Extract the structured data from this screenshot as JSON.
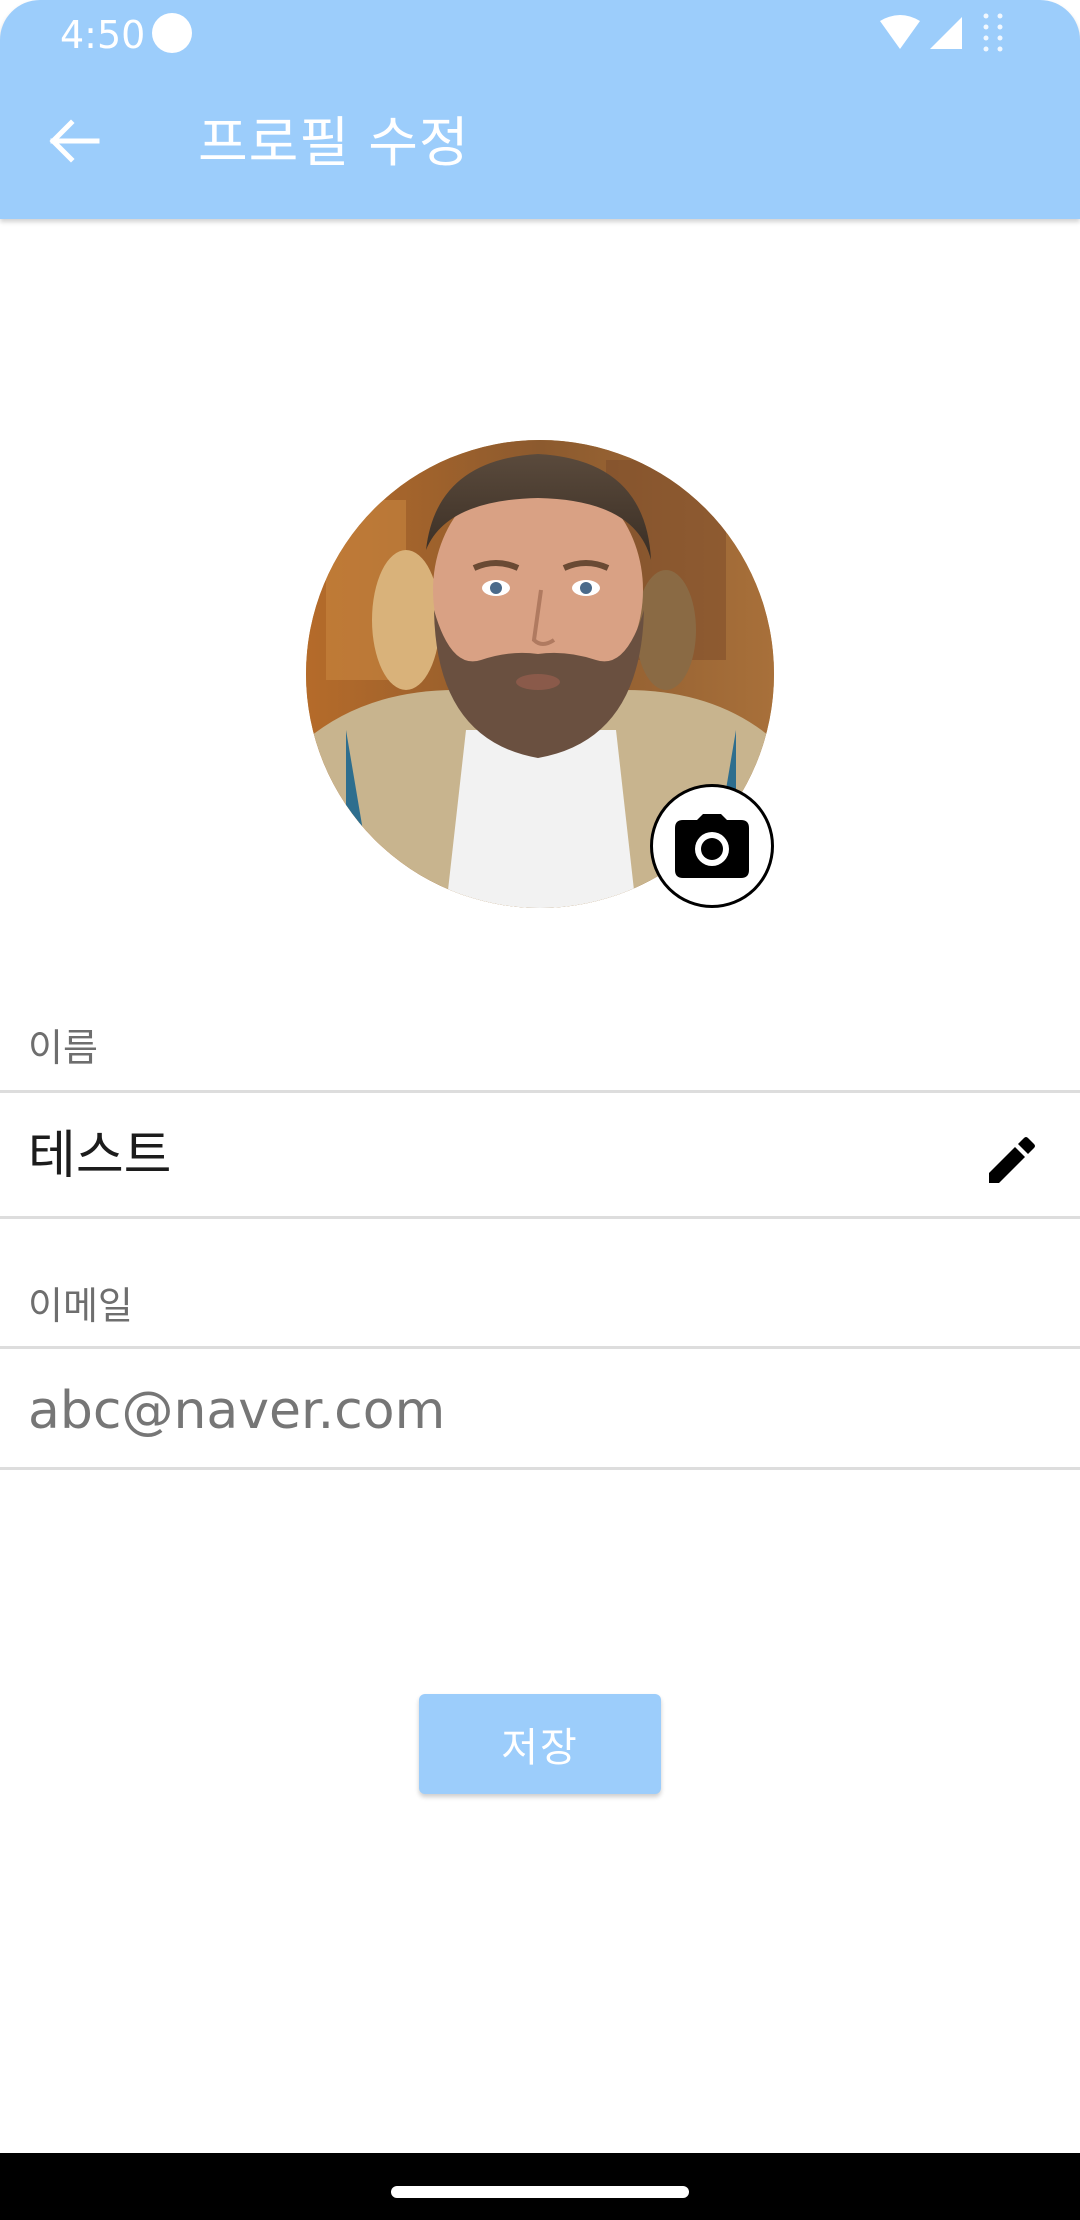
{
  "status_bar": {
    "time": "4:50",
    "icons": [
      "notification-dot-icon",
      "wifi-icon",
      "signal-icon",
      "battery-icon"
    ]
  },
  "app_bar": {
    "back_icon": "arrow-left-icon",
    "title": "프로필 수정"
  },
  "profile": {
    "avatar": "profile-photo",
    "camera_icon": "camera-icon"
  },
  "form": {
    "name": {
      "label": "이름",
      "value": "테스트",
      "edit_icon": "pencil-icon"
    },
    "email": {
      "label": "이메일",
      "value": "abc@naver.com"
    }
  },
  "actions": {
    "save_label": "저장"
  },
  "colors": {
    "primary": "#9ccdfb",
    "text_primary": "#1c1c1c",
    "text_secondary": "#6e6e6e",
    "divider": "#dddddd"
  }
}
